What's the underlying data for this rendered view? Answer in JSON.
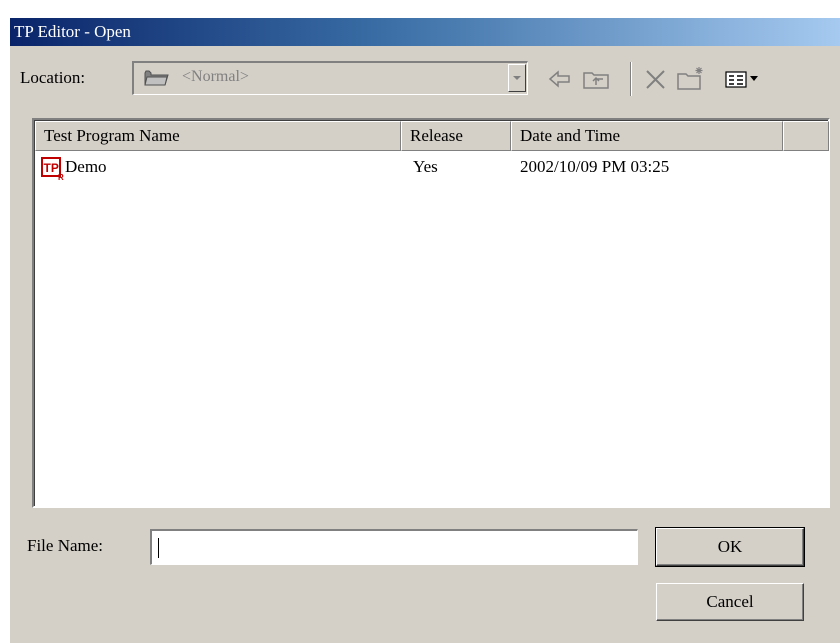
{
  "window": {
    "title": "TP Editor - Open"
  },
  "location": {
    "label": "Location:",
    "value": "<Normal>"
  },
  "toolbar": {
    "icons": [
      "back-arrow-icon",
      "up-folder-icon",
      "delete-icon",
      "new-folder-icon",
      "view-menu-icon"
    ]
  },
  "list": {
    "columns": [
      "Test Program Name",
      "Release",
      "Date and Time"
    ],
    "rows": [
      {
        "name": "Demo",
        "release": "Yes",
        "datetime": "2002/10/09 PM 03:25"
      }
    ]
  },
  "file_name": {
    "label": "File Name:",
    "value": ""
  },
  "buttons": {
    "ok": "OK",
    "cancel": "Cancel"
  }
}
